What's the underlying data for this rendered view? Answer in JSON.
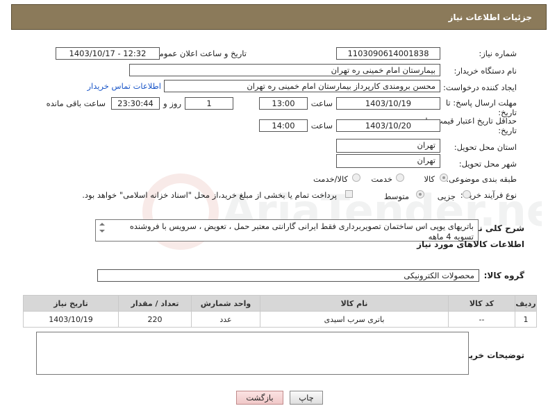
{
  "header": {
    "title": "جزئیات اطلاعات نیاز"
  },
  "fields": {
    "need_number_label": "شماره نیاز:",
    "need_number": "1103090614001838",
    "announce_label": "تاریخ و ساعت اعلان عمومی:",
    "announce_value": "1403/10/17 - 12:32",
    "buyer_org_label": "نام دستگاه خریدار:",
    "buyer_org": "بیمارستان امام خمینی ره  تهران",
    "creator_label": "ایجاد کننده درخواست:",
    "creator": "محسن برومندی کارپرداز بیمارستان امام خمینی ره  تهران",
    "contact_link": "اطلاعات تماس خریدار",
    "deadline_label_1": "مهلت ارسال پاسخ: تا",
    "deadline_label_2": "تاریخ:",
    "deadline_date": "1403/10/19",
    "time_label": "ساعت",
    "deadline_time": "13:00",
    "days_value": "1",
    "days_label": "روز و",
    "remaining_value": "23:30:44",
    "remaining_label": "ساعت باقی مانده",
    "price_label_1": "حداقل تاریخ اعتبار قیمت: تا",
    "price_label_2": "تاریخ:",
    "price_date": "1403/10/20",
    "price_time_label": "ساعت",
    "price_time": "14:00",
    "province_label": "استان محل تحویل:",
    "province": "تهران",
    "city_label": "شهر محل تحویل:",
    "city": "تهران",
    "category_label": "طبقه بندی موضوعی:",
    "category_options": [
      "کالا",
      "خدمت",
      "کالا/خدمت"
    ],
    "process_label": "نوع فرآیند خرید :",
    "process_options": [
      "جزیی",
      "متوسط"
    ],
    "payment_note": "پرداخت تمام یا بخشی از مبلغ خرید،از محل \"اسناد خزانه اسلامی\" خواهد بود.",
    "description_label": "شرح کلی نیاز:",
    "description": "باتریهای یوپی اس ساختمان تصویربرداری فقط ایرانی گارانتی معتبر حمل ، تعویض ، سرویس با فروشنده تسویه 4 ماهه"
  },
  "goods": {
    "section_title": "اطلاعات کالاهای مورد نیاز",
    "group_label": "گروه کالا:",
    "group_value": "محصولات الکترونیکی",
    "columns": [
      "ردیف",
      "کد کالا",
      "نام کالا",
      "واحد شمارش",
      "تعداد / مقدار",
      "تاریخ نیاز"
    ],
    "rows": [
      {
        "row": "1",
        "code": "--",
        "name": "باتری سرب اسیدی",
        "unit": "عدد",
        "qty": "220",
        "date": "1403/10/19"
      }
    ]
  },
  "buyer_notes_label": "توضیحات خریدار:",
  "buttons": {
    "print": "چاپ",
    "back": "بازگشت"
  },
  "watermark_text": "AriaTender.neT",
  "colors": {
    "header_bg": "#8B7A5A",
    "link": "#1a56c8",
    "back_button": "#f0c8c8"
  }
}
